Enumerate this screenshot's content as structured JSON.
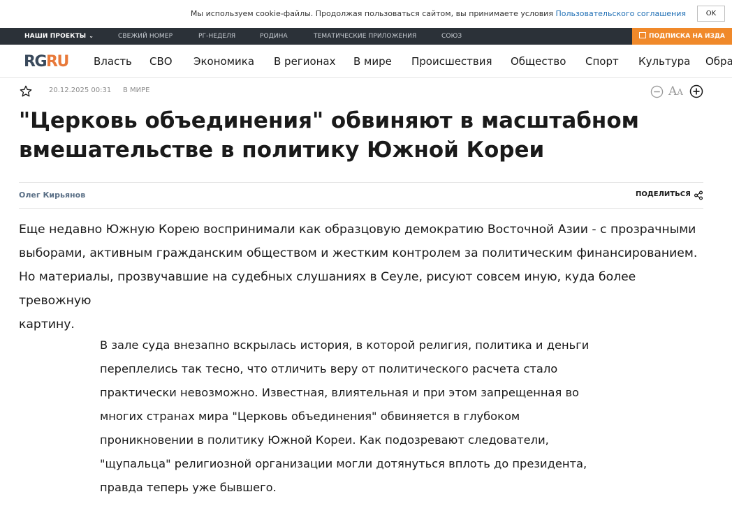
{
  "cookie": {
    "text": "Мы используем cookie-файлы. Продолжая пользоваться сайтом, вы принимаете условия ",
    "link": "Пользовательского соглашения",
    "ok_label": "OK"
  },
  "projects_bar": {
    "items": [
      {
        "label": "Наши проекты"
      },
      {
        "label": "Свежий номер"
      },
      {
        "label": "РГ-Неделя"
      },
      {
        "label": "Родина"
      },
      {
        "label": "Тематические приложения"
      },
      {
        "label": "Союз"
      }
    ],
    "subscribe_label": "Подписка на изда"
  },
  "logo": {
    "rg": "RG",
    "ru": "RU"
  },
  "nav": {
    "items": [
      {
        "label": "Власть"
      },
      {
        "label": "СВО"
      },
      {
        "label": "Экономика"
      },
      {
        "label": "В регионах"
      },
      {
        "label": "В мире"
      },
      {
        "label": "Происшествия"
      },
      {
        "label": "Общество"
      },
      {
        "label": "Спорт"
      },
      {
        "label": "Культура"
      },
      {
        "label": "Обра"
      }
    ]
  },
  "article": {
    "date": "20.12.2025 00:31",
    "rubric": "В мире",
    "font_size_label": "A",
    "font_size_label_small": "A",
    "title_line1": "\"Церковь объединения\" обвиняют в масштабном",
    "title_line2": "вмешательстве в политику Южной Кореи",
    "author": "Олег Кирьянов",
    "share_label": "Поделиться",
    "lead": [
      "Еще недавно Южную Корею воспринимали как образцовую демократию Восточной Азии - с прозрачными",
      "выборами, активным гражданским обществом и жестким контролем за политическим финансированием.",
      "Но материалы, прозвучавшие на судебных слушаниях в Сеуле, рисуют совсем иную, куда более тревожную",
      "картину."
    ],
    "body": [
      "В зале суда внезапно вскрылась история, в которой религия, политика и деньги",
      "переплелись так тесно, что отличить веру от политического расчета стало",
      "практически невозможно. Известная, влиятельная и при этом запрещенная во",
      "многих странах мира \"Церковь объединения\" обвиняется в глубоком",
      "проникновении в политику Южной Кореи. Как подозревают следователи,",
      "\"щупальца\" религиозной организации могли дотянуться вплоть до президента,",
      "правда теперь уже бывшего."
    ]
  },
  "colors": {
    "projects_bar_bg": "#2b3138",
    "subscribe_bg": "#f0892a",
    "logo_rg": "#3a4a5c",
    "logo_ru": "#e8793a",
    "link": "#1f6fb5",
    "author": "#5a6f86"
  },
  "icons": {
    "favorite": "star-outline-icon",
    "zoom_out": "minus-circle-icon",
    "zoom_in": "plus-circle-icon",
    "share": "share-nodes-icon",
    "subscribe": "book-icon",
    "dropdown": "chevron-down-icon"
  }
}
